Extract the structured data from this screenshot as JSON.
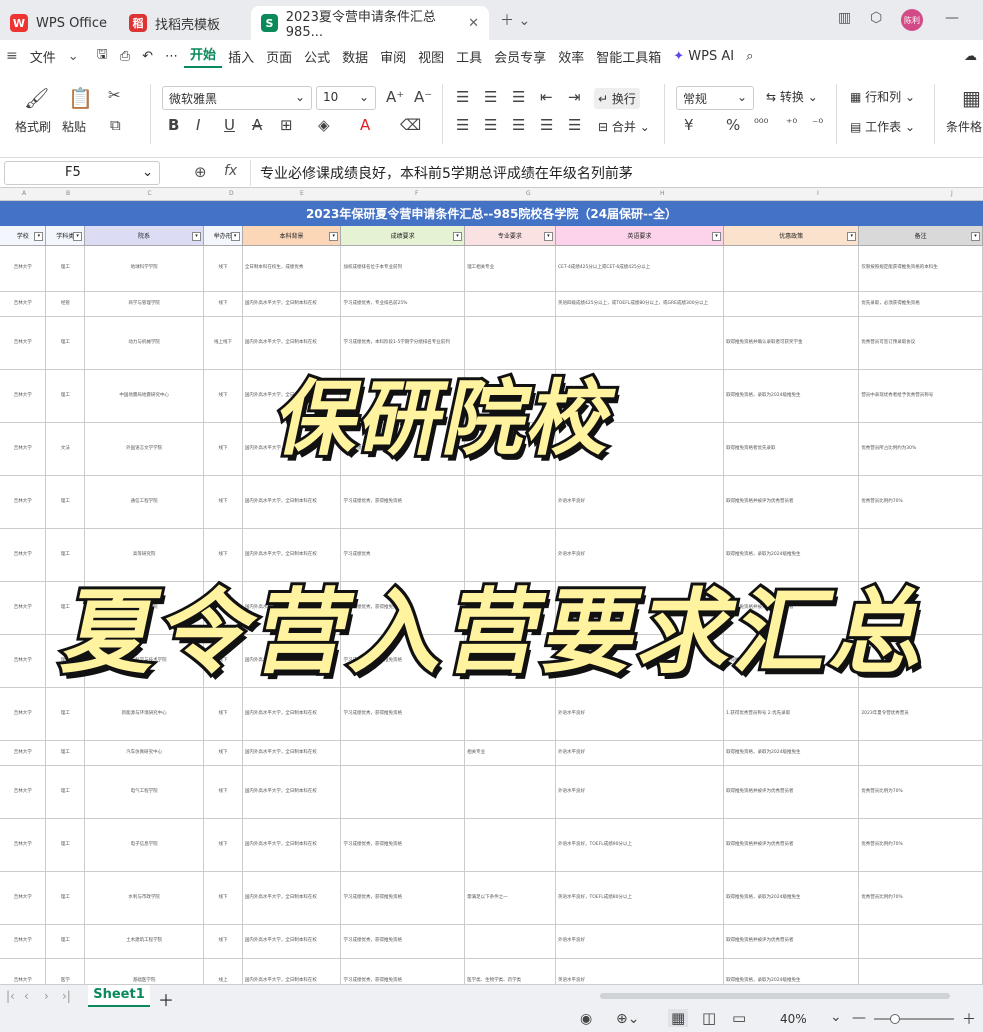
{
  "tabs": [
    {
      "label": "WPS Office",
      "icon": "wps-logo",
      "color": "#e33"
    },
    {
      "label": "找稻壳模板",
      "icon": "docer-logo",
      "color": "#d33"
    },
    {
      "label": "2023夏令营申请条件汇总985...",
      "icon": "sheet-logo",
      "color": "#0a8a5a"
    }
  ],
  "menu": [
    "文件",
    "开始",
    "插入",
    "页面",
    "公式",
    "数据",
    "审阅",
    "视图",
    "工具",
    "会员专享",
    "效率",
    "智能工具箱",
    "WPS AI"
  ],
  "menu_file": "文件",
  "avatar_text": "陈利",
  "ribbon": {
    "format_painter": "格式刷",
    "paste": "粘贴",
    "font": "微软雅黑",
    "size": "10",
    "wrap": "换行",
    "number_format": "常规",
    "convert": "转换",
    "rowcol": "行和列",
    "merge": "合并",
    "worksheet": "工作表",
    "conditional": "条件格"
  },
  "formula": {
    "cell_ref": "F5",
    "fx": "fx",
    "content": "专业必修课成绩良好，本科前5学期总评成绩在年级名列前茅"
  },
  "colletters": [
    "A",
    "B",
    "C",
    "D",
    "E",
    "F",
    "G",
    "H",
    "I",
    "J",
    "K"
  ],
  "sheet": {
    "title": "2023年保研夏令营申请条件汇总--985院校各学院（24届保研--全）",
    "headers": [
      "学校",
      "学科类",
      "院系",
      "举办形",
      "本科背景",
      "成绩要求",
      "专业要求",
      "英语要求",
      "优惠政策",
      "备注"
    ],
    "rows": [
      [
        "吉林大学",
        "理工",
        "地球科学学院",
        "线下",
        "全日制本科在校生，成绩优秀",
        "加权成绩排名位于本专业前列",
        "理工相关专业",
        "CET-4成绩425分以上或CET-6成绩425分以上",
        "",
        "仅限按照规定能获得推免资格的本科生"
      ],
      [
        "吉林大学",
        "经管",
        "商学与管理学院",
        "线下",
        "国内外高水平大学，全日制本科在校",
        "学习成绩优秀，专业排名前25%",
        "",
        "英语四级成绩425分以上，或TOEFL成绩80分以上，或GRE成绩300分以上",
        "",
        "优先录取，必须获得推免资格"
      ],
      [
        "吉林大学",
        "理工",
        "动力与机械学院",
        "线上线下",
        "国内外高水平大学，全日制本科在校",
        "学习成绩优秀，本科阶段1-5学期学分绩排名专业前列",
        "",
        "",
        "取得推免资格并确认录取者可获奖学金",
        "优秀营员可签订预录取协议"
      ],
      [
        "吉林大学",
        "理工",
        "中国地震局地震研究中心",
        "线下",
        "国内外高水平大学，全日制本科在校",
        "",
        "",
        "",
        "取得推免资格，录取为2024级推免生",
        "营员中表现优秀者给予优秀营员称号"
      ],
      [
        "吉林大学",
        "文法",
        "外国语言文学学院",
        "线下",
        "国内外高水平大学，全日制本科在校",
        "学习成绩优秀，获得推免资格",
        "",
        "专业外语水平良好",
        "取得推免资格者优先录取",
        "优秀营员所占比例约为30%"
      ],
      [
        "吉林大学",
        "理工",
        "通信工程学院",
        "线下",
        "国内外高水平大学，全日制本科在校",
        "学习成绩优秀，获得推免资格",
        "",
        "外语水平良好",
        "取得推免资格并被评为优秀营员者",
        "优秀营员比例约70%"
      ],
      [
        "吉林大学",
        "理工",
        "高等研究院",
        "线下",
        "国内外高水平大学，全日制本科在校",
        "学习成绩优秀",
        "",
        "外语水平良好",
        "取得推免资格，录取为2024级推免生",
        ""
      ],
      [
        "吉林大学",
        "理工",
        "生命科学学院",
        "线下",
        "国内外高水平大学，全日制本科在校",
        "学习成绩优秀，获得推免资格",
        "",
        "外语水平良好",
        "取得推免资格并被评为优秀营员者",
        ""
      ],
      [
        "吉林大学",
        "理工",
        "计算机科学与技术学院",
        "线下",
        "国内外高水平大学，全日制本科在校",
        "学习成绩优秀，获得推免资格",
        "",
        "外语水平良好",
        "取得推免资格并被评为优秀营员者",
        ""
      ],
      [
        "吉林大学",
        "理工",
        "新能源与环境研究中心",
        "线下",
        "国内外高水平大学，全日制本科在校",
        "学习成绩优秀，获得推免资格",
        "",
        "外语水平良好",
        "1.获得优秀营员称号 2.优先录取",
        "2023年夏令营优秀营员"
      ],
      [
        "吉林大学",
        "理工",
        "汽车仿真研究中心",
        "线下",
        "国内外高水平大学，全日制本科在校",
        "",
        "相关专业",
        "外语水平良好",
        "取得推免资格，录取为2024级推免生",
        ""
      ],
      [
        "吉林大学",
        "理工",
        "电气工程学院",
        "线下",
        "国内外高水平大学，全日制本科在校",
        "",
        "",
        "外语水平良好",
        "取得推免资格并被评为优秀营员者",
        "优秀营员比例为70%"
      ],
      [
        "吉林大学",
        "理工",
        "电子信息学院",
        "线下",
        "国内外高水平大学，全日制本科在校",
        "学习成绩优秀，获得推免资格",
        "",
        "外语水平良好，TOEFL成绩90分以上",
        "取得推免资格并被评为优秀营员者",
        "优秀营员比例约70%"
      ],
      [
        "吉林大学",
        "理工",
        "水利与市政学院",
        "线下",
        "国内外高水平大学，全日制本科在校",
        "学习成绩优秀，获得推免资格",
        "需满足以下条件之一",
        "英语水平良好，TOEFL成绩80分以上",
        "取得推免资格，录取为2024级推免生",
        "优秀营员比例约70%"
      ],
      [
        "吉林大学",
        "理工",
        "土木建筑工程学院",
        "线下",
        "国内外高水平大学，全日制本科在校",
        "学习成绩优秀，获得推免资格",
        "",
        "外语水平良好",
        "取得推免资格并被评为优秀营员者",
        ""
      ],
      [
        "吉林大学",
        "医学",
        "基础医学院",
        "线上",
        "国内外高水平大学，全日制本科在校",
        "学习成绩优秀，获得推免资格",
        "医学类、生物学类、药学类",
        "英语水平良好",
        "取得推免资格，录取为2024级推免生",
        ""
      ]
    ]
  },
  "overlay": {
    "line1": "保研院校",
    "line2": "夏令营入营要求汇总"
  },
  "status": {
    "sheet_tab": "Sheet1",
    "zoom": "40%"
  }
}
